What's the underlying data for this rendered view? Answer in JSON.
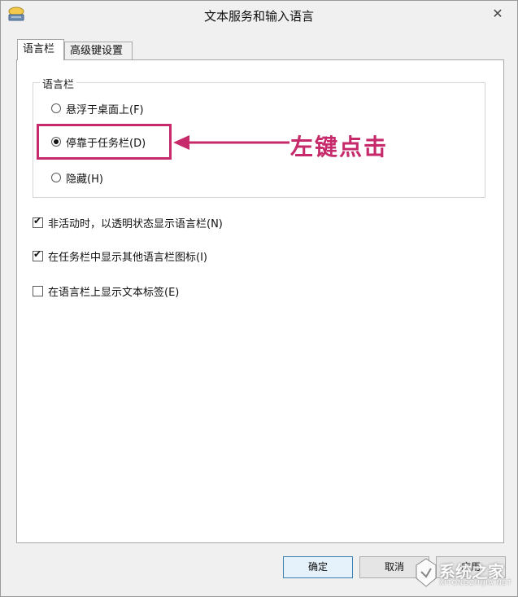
{
  "window": {
    "title": "文本服务和输入语言",
    "close_glyph": "✕"
  },
  "tabs": [
    {
      "label": "语言栏",
      "active": true
    },
    {
      "label": "高级键设置",
      "active": false
    }
  ],
  "language_bar_group": {
    "title": "语言栏",
    "options": [
      {
        "label": "悬浮于桌面上(F)",
        "checked": false
      },
      {
        "label": "停靠于任务栏(D)",
        "checked": true
      },
      {
        "label": "隐藏(H)",
        "checked": false
      }
    ]
  },
  "checkboxes": [
    {
      "label": "非活动时，以透明状态显示语言栏(N)",
      "checked": true
    },
    {
      "label": "在任务栏中显示其他语言栏图标(I)",
      "checked": true
    },
    {
      "label": "在语言栏上显示文本标签(E)",
      "checked": false
    }
  ],
  "annotation": {
    "text": "左键点击",
    "color": "#c62a6b"
  },
  "buttons": {
    "ok_label": "确定",
    "cancel_label": "取消",
    "apply_label": "应用"
  },
  "watermark": {
    "text": "系统之家",
    "sub": "XITONGZHIJIA.NET"
  }
}
